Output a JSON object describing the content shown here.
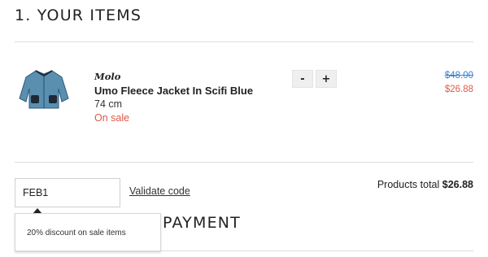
{
  "section": {
    "title": "1. YOUR ITEMS"
  },
  "product": {
    "brand": "Molo",
    "name": "Umo Fleece Jacket In Scifi Blue",
    "size": "74 cm",
    "sale_label": "On sale",
    "image_icon": "jacket-thumbnail",
    "price_original": "$48.00",
    "price_current": "$26.88"
  },
  "quantity": {
    "decrement_label": "-",
    "increment_label": "+"
  },
  "promo": {
    "code_value": "FEB1",
    "validate_label": "Validate code",
    "tooltip_text": "20% discount on sale items"
  },
  "totals": {
    "label": "Products total",
    "value": "$26.88"
  },
  "payment": {
    "title_visible": "PAYMENT"
  },
  "colors": {
    "sale": "#e0584b",
    "strike_price": "#3a7ed0",
    "divider": "#dcdcdc"
  }
}
